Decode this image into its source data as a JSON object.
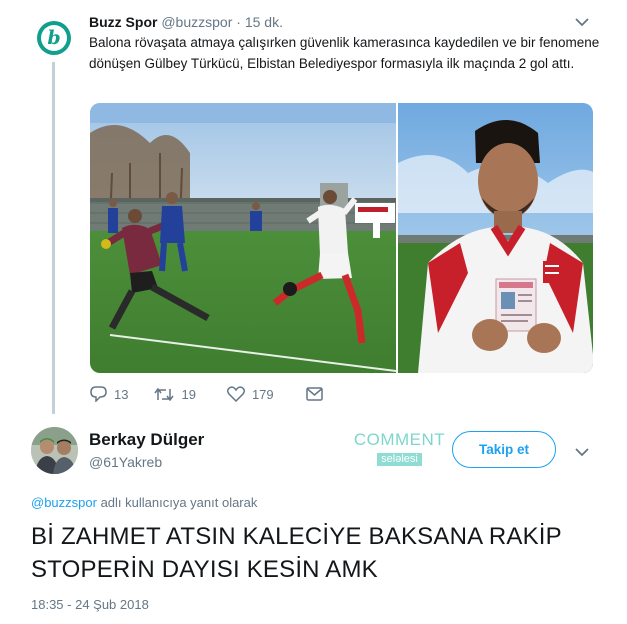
{
  "tweet1": {
    "name": "Buzz Spor",
    "handle": "@buzzspor",
    "separator": "·",
    "time": "15 dk.",
    "avatar_letter": "b",
    "text": "Balona rövaşata atmaya çalışırken güvenlik kamerasınca kaydedilen ve bir fenomene dönüşen Gülbey Türkücü, Elbistan Belediyespor formasıyla ilk maçında 2 gol attı.",
    "replies": "13",
    "retweets": "19",
    "likes": "179"
  },
  "tweet2": {
    "name": "Berkay Dülger",
    "handle": "@61Yakreb",
    "follow_label": "Takip et",
    "reply_mention": "@buzzspor",
    "reply_suffix": " adlı kullanıcıya yanıt olarak",
    "text": "Bİ ZAHMET ATSIN KALECİYE BAKSANA RAKİP STOPERİN DAYISI KESİN AMK",
    "timestamp": "18:35 - 24 Şub 2018"
  },
  "watermark": {
    "top": "COMMENT",
    "sub": "seləlesi"
  },
  "icons": {
    "reply": "reply-icon",
    "retweet": "retweet-icon",
    "like": "heart-icon",
    "dm": "envelope-icon",
    "caret": "chevron-down-icon"
  },
  "colors": {
    "brand_teal": "#0f9f8c",
    "link_blue": "#1da1f2",
    "muted_gray": "#657786",
    "thread_line": "#c4cfd6"
  }
}
